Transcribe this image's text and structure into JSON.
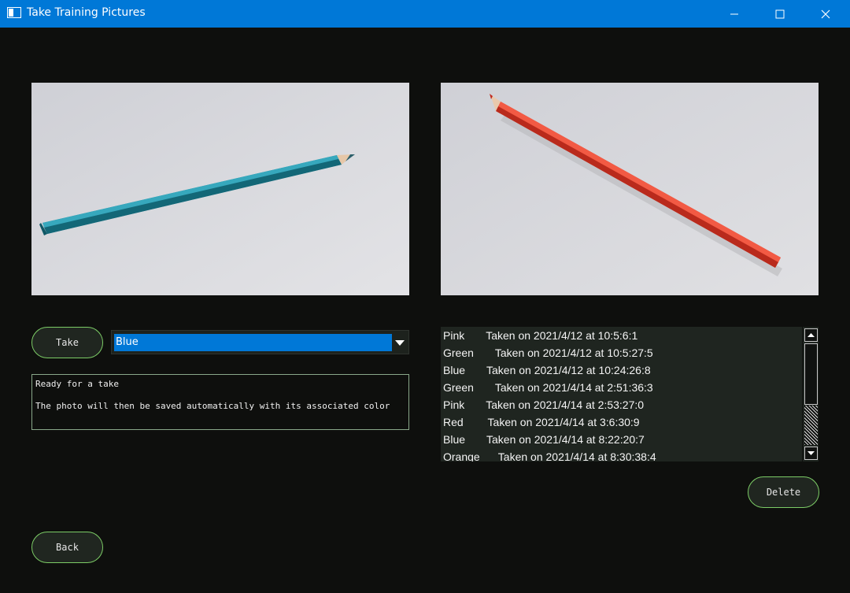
{
  "window": {
    "title": "Take Training Pictures",
    "titlebar_color": "#0078d7"
  },
  "camera": {
    "take_label": "Take",
    "color_select": {
      "selected": "Blue"
    },
    "status_text": "Ready for a take\n\nThe photo will then be saved automatically with its associated color",
    "preview_icon": "blue-pencil-photo"
  },
  "gallery": {
    "selected_icon": "red-pencil-photo",
    "items": [
      {
        "text": "Pink       Taken on 2021/4/12 at 10:5:6:1"
      },
      {
        "text": "Green       Taken on 2021/4/12 at 10:5:27:5"
      },
      {
        "text": "Blue       Taken on 2021/4/12 at 10:24:26:8"
      },
      {
        "text": "Green       Taken on 2021/4/14 at 2:51:36:3"
      },
      {
        "text": "Pink       Taken on 2021/4/14 at 2:53:27:0"
      },
      {
        "text": "Red        Taken on 2021/4/14 at 3:6:30:9"
      },
      {
        "text": "Blue       Taken on 2021/4/14 at 8:22:20:7"
      },
      {
        "text": "Orange      Taken on 2021/4/14 at 8:30:38:4"
      }
    ],
    "delete_label": "Delete"
  },
  "nav": {
    "back_label": "Back"
  }
}
